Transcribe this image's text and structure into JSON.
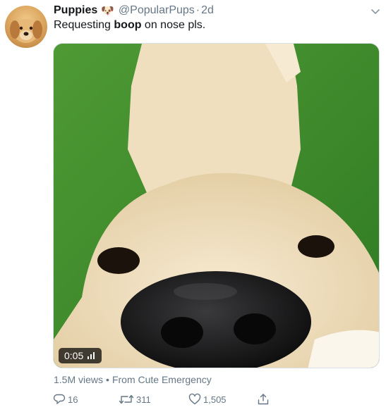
{
  "tweet": {
    "display_name": "Puppies",
    "name_emoji": "🐶",
    "handle": "@PopularPups",
    "separator": "·",
    "time": "2d",
    "text_before": "Requesting ",
    "text_bold": "boop",
    "text_after": " on nose pls."
  },
  "media": {
    "duration": "0:05",
    "views": "1.5M views",
    "views_separator": "•",
    "source": "From Cute Emergency"
  },
  "actions": {
    "replies": "16",
    "retweets": "311",
    "likes": "1,505"
  },
  "icons": {
    "avatar": "puppy-avatar",
    "menu": "chevron-down-icon",
    "sound": "sound-bars-icon",
    "reply": "reply-icon",
    "retweet": "retweet-icon",
    "like": "heart-icon",
    "share": "share-icon"
  },
  "colors": {
    "text": "#14171a",
    "secondary": "#657786",
    "badge_bg": "#000000"
  }
}
